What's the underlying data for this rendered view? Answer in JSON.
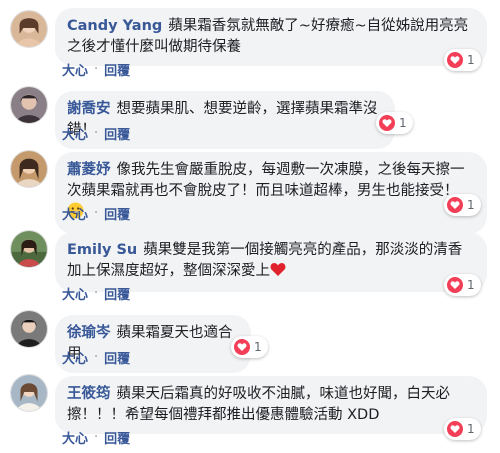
{
  "comments": [
    {
      "name": "Candy Yang",
      "text": "蘋果霜香氛就無敵了~好療癒~自從姊說用亮亮之後才懂什麼叫做期待保養",
      "actions": {
        "like": "大心",
        "reply": "回覆"
      },
      "reactions": {
        "icon": "heart-icon",
        "count": "1"
      },
      "avatar_color": "#d9b89a"
    },
    {
      "name": "謝喬安",
      "text": "想要蘋果肌、想要逆齡，選擇蘋果霜準沒錯！",
      "actions": {
        "like": "大心",
        "reply": "回覆"
      },
      "reactions": {
        "icon": "heart-icon",
        "count": "1"
      },
      "avatar_color": "#8a7f86"
    },
    {
      "name": "蕭菱妤",
      "text": "像我先生會嚴重脫皮，每週敷一次凍膜，之後每天擦一次蘋果霜就再也不會脫皮了！而且味道超棒，男生也能接受！",
      "emoji": "grinning-emoji",
      "actions": {
        "like": "大心",
        "reply": "回覆"
      },
      "reactions": {
        "icon": "heart-icon",
        "count": "1"
      },
      "avatar_color": "#c49a6c"
    },
    {
      "name": "Emily Su",
      "text": "蘋果雙是我第一個接觸亮亮的產品，那淡淡的清香加上保濕度超好，整個深深愛上",
      "emoji": "red-heart-emoji",
      "actions": {
        "like": "大心",
        "reply": "回覆"
      },
      "reactions": {
        "icon": "heart-icon",
        "count": "1"
      },
      "avatar_color": "#6f8f5e"
    },
    {
      "name": "徐瑜岑",
      "text": "蘋果霜夏天也適合用",
      "actions": {
        "like": "大心",
        "reply": "回覆"
      },
      "reactions": {
        "icon": "heart-icon",
        "count": "1"
      },
      "avatar_color": "#7a7a7a"
    },
    {
      "name": "王筱筠",
      "text": "蘋果天后霜真的好吸收不油膩，味道也好聞，白天必擦！！！希望每個禮拜都推出優惠體驗活動 XDD",
      "actions": {
        "like": "大心",
        "reply": "回覆"
      },
      "reactions": {
        "icon": "heart-icon",
        "count": "1"
      },
      "avatar_color": "#a8b7c6"
    }
  ],
  "separator": "·",
  "colors": {
    "name": "#385898",
    "bubble": "#f2f3f5",
    "heart": "#f33e58"
  }
}
